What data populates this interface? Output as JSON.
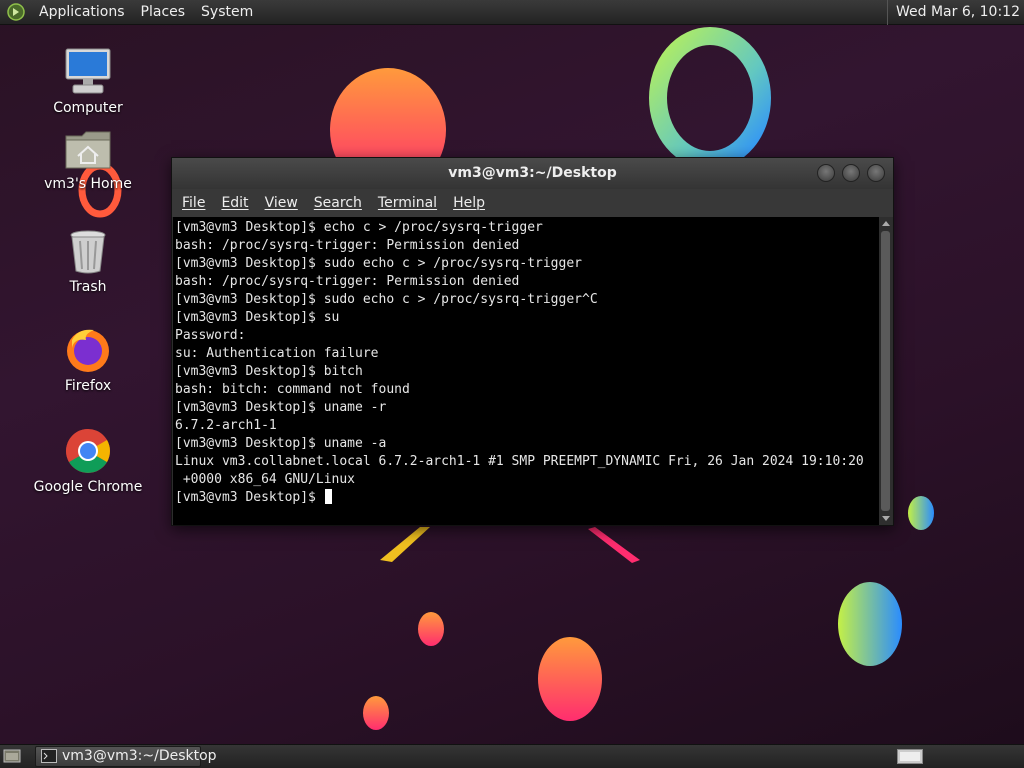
{
  "top_panel": {
    "menus": [
      "Applications",
      "Places",
      "System"
    ],
    "clock": "Wed Mar 6, 10:12"
  },
  "desktop_icons": [
    {
      "label": "Computer",
      "icon": "computer-icon"
    },
    {
      "label": "vm3's Home",
      "icon": "home-folder-icon"
    },
    {
      "label": "Trash",
      "icon": "trash-icon"
    },
    {
      "label": "Firefox",
      "icon": "firefox-icon"
    },
    {
      "label": "Google Chrome",
      "icon": "chrome-icon"
    }
  ],
  "terminal": {
    "title": "vm3@vm3:~/Desktop",
    "menu": [
      "File",
      "Edit",
      "View",
      "Search",
      "Terminal",
      "Help"
    ],
    "lines": [
      "[vm3@vm3 Desktop]$ echo c > /proc/sysrq-trigger",
      "bash: /proc/sysrq-trigger: Permission denied",
      "[vm3@vm3 Desktop]$ sudo echo c > /proc/sysrq-trigger",
      "bash: /proc/sysrq-trigger: Permission denied",
      "[vm3@vm3 Desktop]$ sudo echo c > /proc/sysrq-trigger^C",
      "[vm3@vm3 Desktop]$ su",
      "Password:",
      "su: Authentication failure",
      "[vm3@vm3 Desktop]$ bitch",
      "bash: bitch: command not found",
      "[vm3@vm3 Desktop]$ uname -r",
      "6.7.2-arch1-1",
      "[vm3@vm3 Desktop]$ uname -a",
      "Linux vm3.collabnet.local 6.7.2-arch1-1 #1 SMP PREEMPT_DYNAMIC Fri, 26 Jan 2024 19:10:20",
      " +0000 x86_64 GNU/Linux"
    ],
    "prompt": "[vm3@vm3 Desktop]$ "
  },
  "bottom_panel": {
    "task_label": "vm3@vm3:~/Desktop"
  }
}
